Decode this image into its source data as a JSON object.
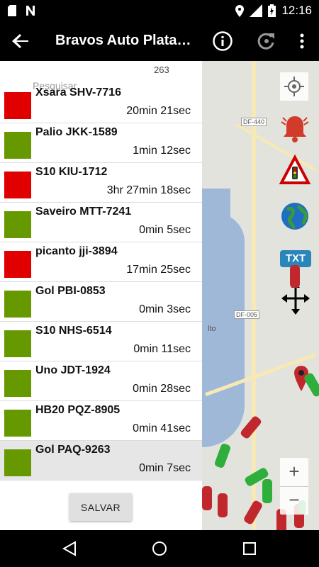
{
  "status_bar": {
    "time": "12:16",
    "network": "LTE"
  },
  "toolbar": {
    "title": "Bravos Auto Platafo…"
  },
  "panel": {
    "count": "263",
    "search_placeholder": "Pesquisar",
    "items": [
      {
        "name": "Xsara SHV-7716",
        "time": "20min 21sec",
        "status": "red"
      },
      {
        "name": "Palio JKK-1589",
        "time": "1min 12sec",
        "status": "green"
      },
      {
        "name": "S10 KIU-1712",
        "time": "3hr 27min 18sec",
        "status": "red"
      },
      {
        "name": "Saveiro MTT-7241",
        "time": "0min 5sec",
        "status": "green"
      },
      {
        "name": "picanto jji-3894",
        "time": "17min 25sec",
        "status": "red"
      },
      {
        "name": "Gol PBI-0853",
        "time": "0min 3sec",
        "status": "green"
      },
      {
        "name": "S10 NHS-6514",
        "time": "0min 11sec",
        "status": "green"
      },
      {
        "name": "Uno JDT-1924",
        "time": "0min 28sec",
        "status": "green"
      },
      {
        "name": "HB20 PQZ-8905",
        "time": "0min 41sec",
        "status": "green"
      },
      {
        "name": "Gol PAQ-9263",
        "time": "0min 7sec",
        "status": "green"
      }
    ],
    "save_label": "SALVAR"
  },
  "map": {
    "labels": [
      "DF-440",
      "DF-005",
      "lto"
    ],
    "txt_label": "TXT",
    "zoom_in": "+",
    "zoom_out": "−"
  },
  "colors": {
    "red": "#e00000",
    "green": "#669900"
  }
}
